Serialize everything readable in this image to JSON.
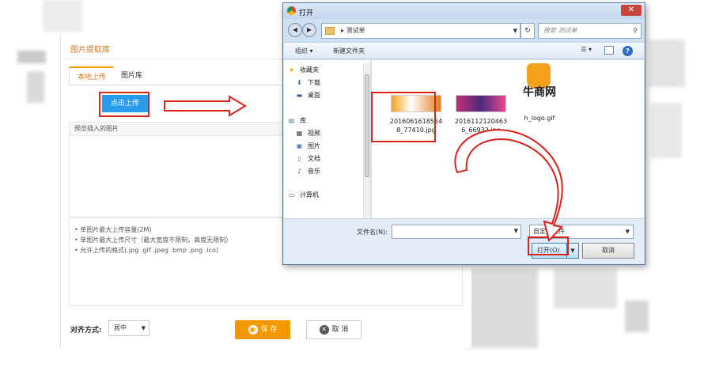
{
  "panel": {
    "title": "图片提取库",
    "tabs": [
      {
        "label": "本地上传"
      },
      {
        "label": "图片库"
      }
    ],
    "upload_button": "点击上传",
    "preview_header": "预览插入的图片",
    "rules": [
      "单图片最大上传容量(2M)",
      "单图片最大上传尺寸（最大宽度不限制，高度无限制）",
      "允许上传的格式(.jpg .gif .jpeg .bmp .png .ico)"
    ],
    "align_label": "对齐方式:",
    "align_value": "居中",
    "save_button": "保 存",
    "cancel_button": "取 消"
  },
  "dialog": {
    "title": "打开",
    "path": "测试单",
    "search_placeholder": "搜索 测试单",
    "toolbar": {
      "organize": "组织 ▾",
      "new_folder": "新建文件夹"
    },
    "nav": {
      "favorites": "收藏夹",
      "items": [
        "下载",
        "桌面"
      ],
      "library": "库",
      "library_items": [
        "视频",
        "图片",
        "文档",
        "音乐"
      ],
      "computer": "计算机"
    },
    "files": [
      {
        "name_line1": "2016061618554",
        "name_line2": "8_77410.jpg"
      },
      {
        "name_line1": "2016112120463",
        "name_line2": "6_66932.jpg"
      },
      {
        "name_line1": "h_logo.gif",
        "name_line2": ""
      }
    ],
    "logo_text": "牛商网",
    "filename_label": "文件名(N):",
    "filetype_value": "自定义文件",
    "open_button": "打开(O)",
    "cancel_button": "取消"
  },
  "colors": {
    "accent_orange": "#f39800",
    "annotation_red": "#d9231b",
    "upload_blue": "#2a9cef"
  }
}
